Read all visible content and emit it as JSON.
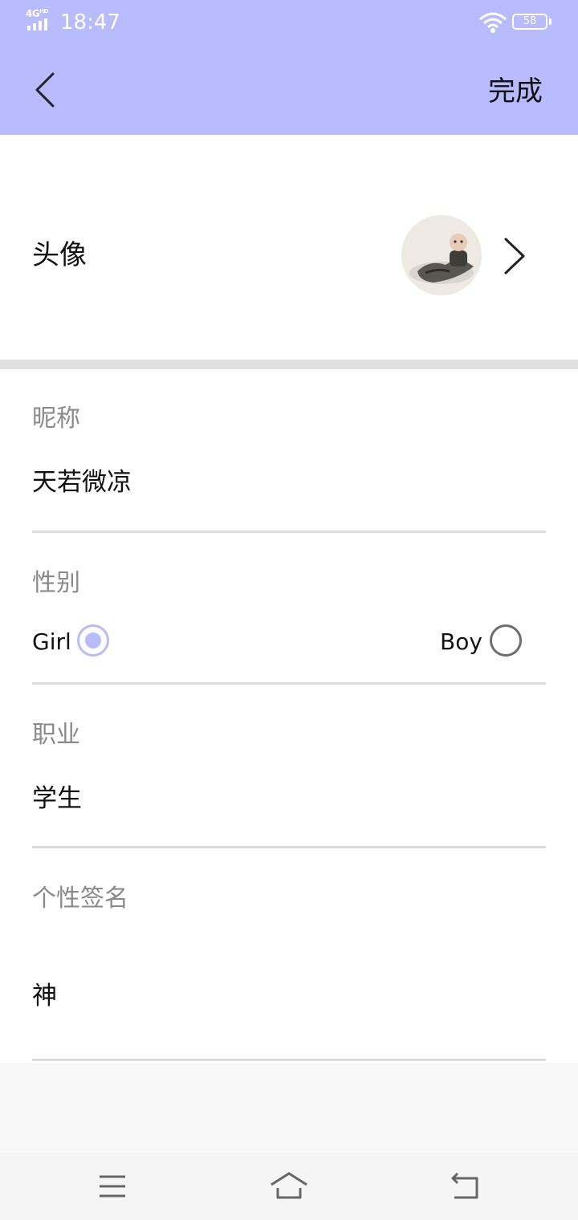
{
  "status_bar": {
    "network": "4G",
    "network_sup": "HD",
    "time": "18:47",
    "battery": "58"
  },
  "header": {
    "done_label": "完成",
    "accent_color": "#b8bbfd"
  },
  "avatar_row": {
    "label": "头像"
  },
  "fields": {
    "nickname_label": "昵称",
    "nickname_value": "天若微凉",
    "gender_label": "性别",
    "gender_options": [
      "Girl",
      "Boy"
    ],
    "gender_selected": "Girl",
    "job_label": "职业",
    "job_value": "学生",
    "signature_label": "个性签名",
    "signature_value": "神"
  },
  "nav_bar": {
    "icons": [
      "menu-icon",
      "home-icon",
      "back-icon"
    ]
  }
}
